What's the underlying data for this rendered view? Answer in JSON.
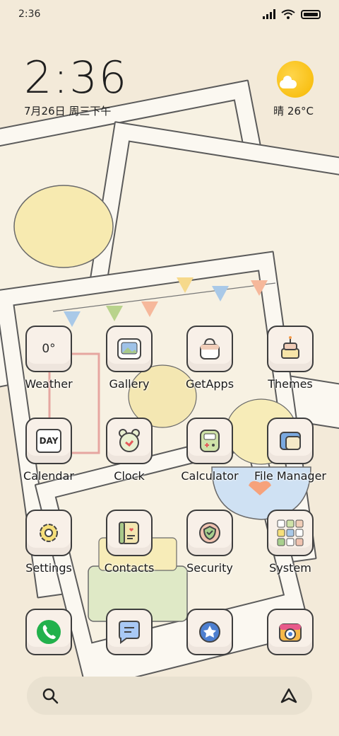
{
  "status_bar": {
    "time": "2:36"
  },
  "clock_widget": {
    "time": "2:36",
    "date": "7月26日 周三下午"
  },
  "weather_widget": {
    "text": "晴 26°C",
    "weather_icon": "sun-cloud-icon"
  },
  "apps": [
    {
      "label": "Weather",
      "icon": "weather-icon",
      "icon_text": "0°"
    },
    {
      "label": "Gallery",
      "icon": "gallery-icon"
    },
    {
      "label": "GetApps",
      "icon": "shopping-bag-icon"
    },
    {
      "label": "Themes",
      "icon": "cake-icon"
    },
    {
      "label": "Calendar",
      "icon": "calendar-icon",
      "icon_text": "DAY"
    },
    {
      "label": "Clock",
      "icon": "alarm-clock-icon"
    },
    {
      "label": "Calculator",
      "icon": "calculator-icon"
    },
    {
      "label": "File Manager",
      "icon": "folder-icon"
    },
    {
      "label": "Settings",
      "icon": "gear-icon"
    },
    {
      "label": "Contacts",
      "icon": "contacts-book-icon"
    },
    {
      "label": "Security",
      "icon": "shield-check-icon"
    },
    {
      "label": "System",
      "icon": "system-folder-icon"
    }
  ],
  "dock": [
    {
      "icon": "phone-icon"
    },
    {
      "icon": "messages-icon"
    },
    {
      "icon": "browser-icon"
    },
    {
      "icon": "camera-icon"
    }
  ],
  "search_bar": {
    "left_icon": "search-icon",
    "right_icon": "assistant-icon"
  },
  "colors": {
    "background": "#f3ead9",
    "sun": "#f6b800",
    "phone_green": "#22b14c",
    "message_blue": "#a9c9f5"
  }
}
